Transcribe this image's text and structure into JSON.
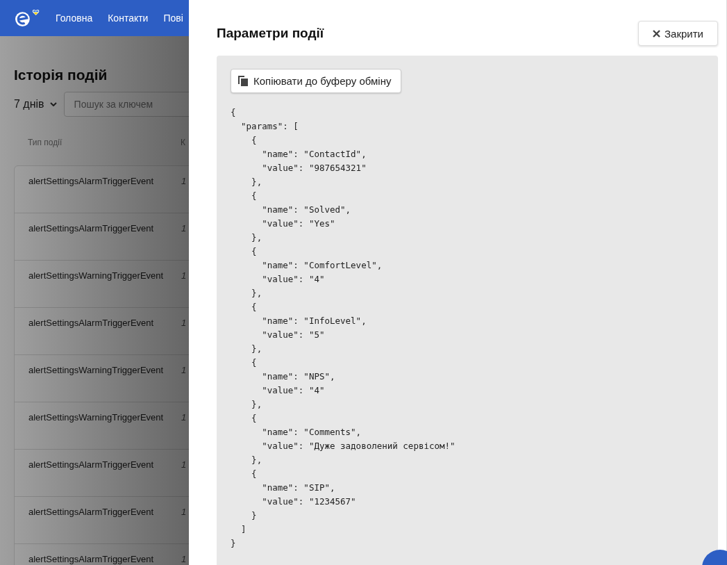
{
  "nav": {
    "items": [
      "Головна",
      "Контакти",
      "Пові"
    ]
  },
  "page": {
    "title": "Історія подій",
    "period": "7 днів",
    "search": {
      "placeholder": "Пошук за ключем"
    },
    "columns": [
      "Тип події",
      "К"
    ],
    "rows": [
      {
        "type": "alertSettingsAlarmTriggerEvent",
        "column_2": "1"
      },
      {
        "type": "alertSettingsAlarmTriggerEvent",
        "column_2": "1"
      },
      {
        "type": "alertSettingsWarningTriggerEvent",
        "column_2": "1"
      },
      {
        "type": "alertSettingsAlarmTriggerEvent",
        "column_2": "1"
      },
      {
        "type": "alertSettingsWarningTriggerEvent",
        "column_2": "1"
      },
      {
        "type": "alertSettingsWarningTriggerEvent",
        "column_2": "1"
      },
      {
        "type": "alertSettingsAlarmTriggerEvent",
        "column_2": "1"
      },
      {
        "type": "alertSettingsAlarmTriggerEvent",
        "column_2": "1"
      },
      {
        "type": "alertSettingsAlarmTriggerEvent",
        "column_2": "1"
      }
    ]
  },
  "drawer": {
    "title": "Параметри події",
    "close_button": "Закрити",
    "copy_button": "Копіювати до буферу обміну",
    "code": "{\n  \"params\": [\n    {\n      \"name\": \"ContactId\",\n      \"value\": \"987654321\"\n    },\n    {\n      \"name\": \"Solved\",\n      \"value\": \"Yes\"\n    },\n    {\n      \"name\": \"ComfortLevel\",\n      \"value\": \"4\"\n    },\n    {\n      \"name\": \"InfoLevel\",\n      \"value\": \"5\"\n    },\n    {\n      \"name\": \"NPS\",\n      \"value\": \"4\"\n    },\n    {\n      \"name\": \"Comments\",\n      \"value\": \"Дуже задоволений сервісом!\"\n    },\n    {\n      \"name\": \"SIP\",\n      \"value\": \"1234567\"\n    }\n  ]\n}"
  }
}
